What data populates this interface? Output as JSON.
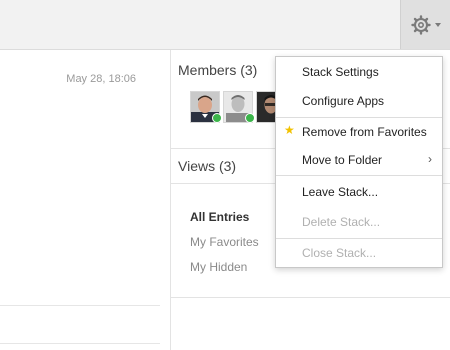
{
  "left": {
    "timestamp": "May 28, 18:06"
  },
  "members": {
    "heading": "Members (3)"
  },
  "views": {
    "heading": "Views (3)",
    "items": [
      {
        "label": "All Entries"
      },
      {
        "label": "My Favorites"
      },
      {
        "label": "My Hidden"
      }
    ]
  },
  "menu": {
    "items": [
      {
        "label": "Stack Settings",
        "enabled": true
      },
      {
        "label": "Configure Apps",
        "enabled": true
      },
      {
        "label": "Remove from Favorites",
        "enabled": true,
        "icon": "star-icon"
      },
      {
        "label": "Move to Folder",
        "enabled": true,
        "icon": "chevron-right-icon"
      },
      {
        "label": "Leave Stack...",
        "enabled": true
      },
      {
        "label": "Delete Stack...",
        "enabled": false
      },
      {
        "label": "Close Stack...",
        "enabled": false
      }
    ]
  },
  "icons": {
    "settings": "gear-icon",
    "dropdown": "caret-down-icon",
    "favorite": "star-icon",
    "submenu": "chevron-right-icon",
    "online": "status-online-icon"
  },
  "colors": {
    "favorite_star": "#f2c200",
    "online_status": "#3bb54a",
    "disabled_text": "#b0b0b0"
  }
}
